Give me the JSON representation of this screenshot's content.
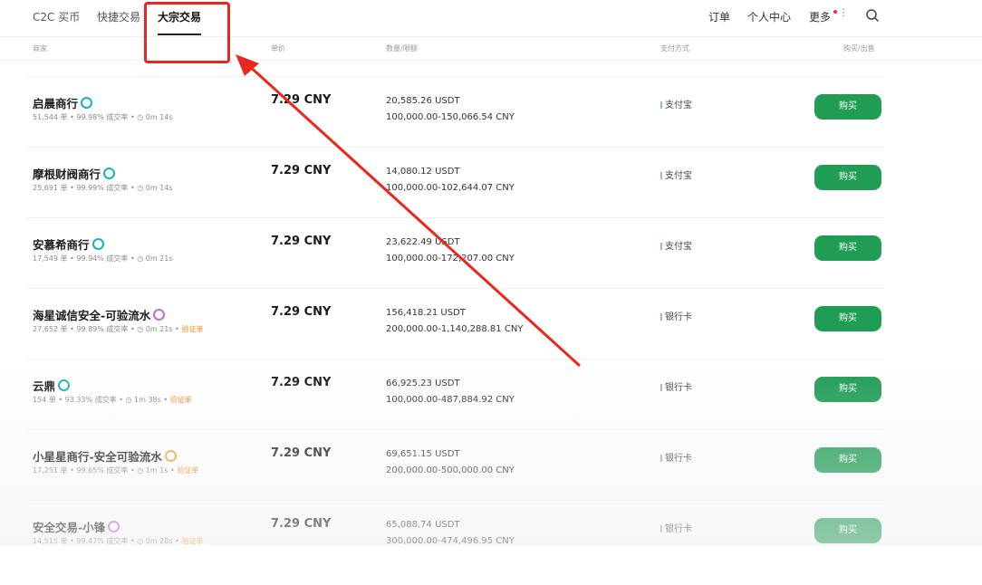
{
  "nav": {
    "tabs": [
      {
        "label": "C2C 买币"
      },
      {
        "label": "快捷交易"
      },
      {
        "label": "大宗交易"
      }
    ],
    "orders": "订单",
    "profile": "个人中心",
    "more": "更多"
  },
  "table_headers": {
    "merchant": "商家",
    "price": "单价",
    "qty": "数量/限额",
    "payment": "支付方式",
    "action": "购买/出售"
  },
  "rows": [
    {
      "name": "启晨商行",
      "orders": "51,544 单",
      "rate": "99.98% 成交率",
      "time": "0m 14s",
      "verify": "",
      "price": "7.29 CNY",
      "amount": "20,585.26 USDT",
      "limit": "100,000.00-150,066.54 CNY",
      "pay": "支付宝",
      "btn": "购买"
    },
    {
      "name": "摩根财阀商行",
      "orders": "25,691 单",
      "rate": "99.99% 成交率",
      "time": "0m 14s",
      "verify": "",
      "price": "7.29 CNY",
      "amount": "14,080.12 USDT",
      "limit": "100,000.00-102,644.07 CNY",
      "pay": "支付宝",
      "btn": "购买"
    },
    {
      "name": "安慕希商行",
      "orders": "17,549 单",
      "rate": "99.94% 成交率",
      "time": "0m 21s",
      "verify": "",
      "price": "7.29 CNY",
      "amount": "23,622.49 USDT",
      "limit": "100,000.00-172,207.00 CNY",
      "pay": "支付宝",
      "btn": "购买"
    },
    {
      "name": "海星诚信安全-可验流水",
      "orders": "27,652 单",
      "rate": "99.89% 成交率",
      "time": "0m 21s",
      "verify": "验证单",
      "price": "7.29 CNY",
      "amount": "156,418.21 USDT",
      "limit": "200,000.00-1,140,288.81 CNY",
      "pay": "银行卡",
      "btn": "购买"
    },
    {
      "name": "云鼎",
      "orders": "154 单",
      "rate": "93.33% 成交率",
      "time": "1m 38s",
      "verify": "验证单",
      "price": "7.29 CNY",
      "amount": "66,925.23 USDT",
      "limit": "100,000.00-487,884.92 CNY",
      "pay": "银行卡",
      "btn": "购买"
    },
    {
      "name": "小星星商行-安全可验流水",
      "orders": "17,251 单",
      "rate": "99.65% 成交率",
      "time": "1m 1s",
      "verify": "验证单",
      "price": "7.29 CNY",
      "amount": "69,651.15 USDT",
      "limit": "200,000.00-500,000.00 CNY",
      "pay": "银行卡",
      "btn": "购买"
    },
    {
      "name": "安全交易-小锋",
      "orders": "14,515 单",
      "rate": "99.47% 成交率",
      "time": "0m 28s",
      "verify": "验证单",
      "price": "7.29 CNY",
      "amount": "65,088.74 USDT",
      "limit": "300,000.00-474,496.95 CNY",
      "pay": "银行卡",
      "btn": "购买"
    }
  ],
  "badges": [
    "teal",
    "teal",
    "teal",
    "purple",
    "teal",
    "fire",
    "purple"
  ],
  "accent_color": "#1f9d55",
  "highlight_color": "#e8281e"
}
